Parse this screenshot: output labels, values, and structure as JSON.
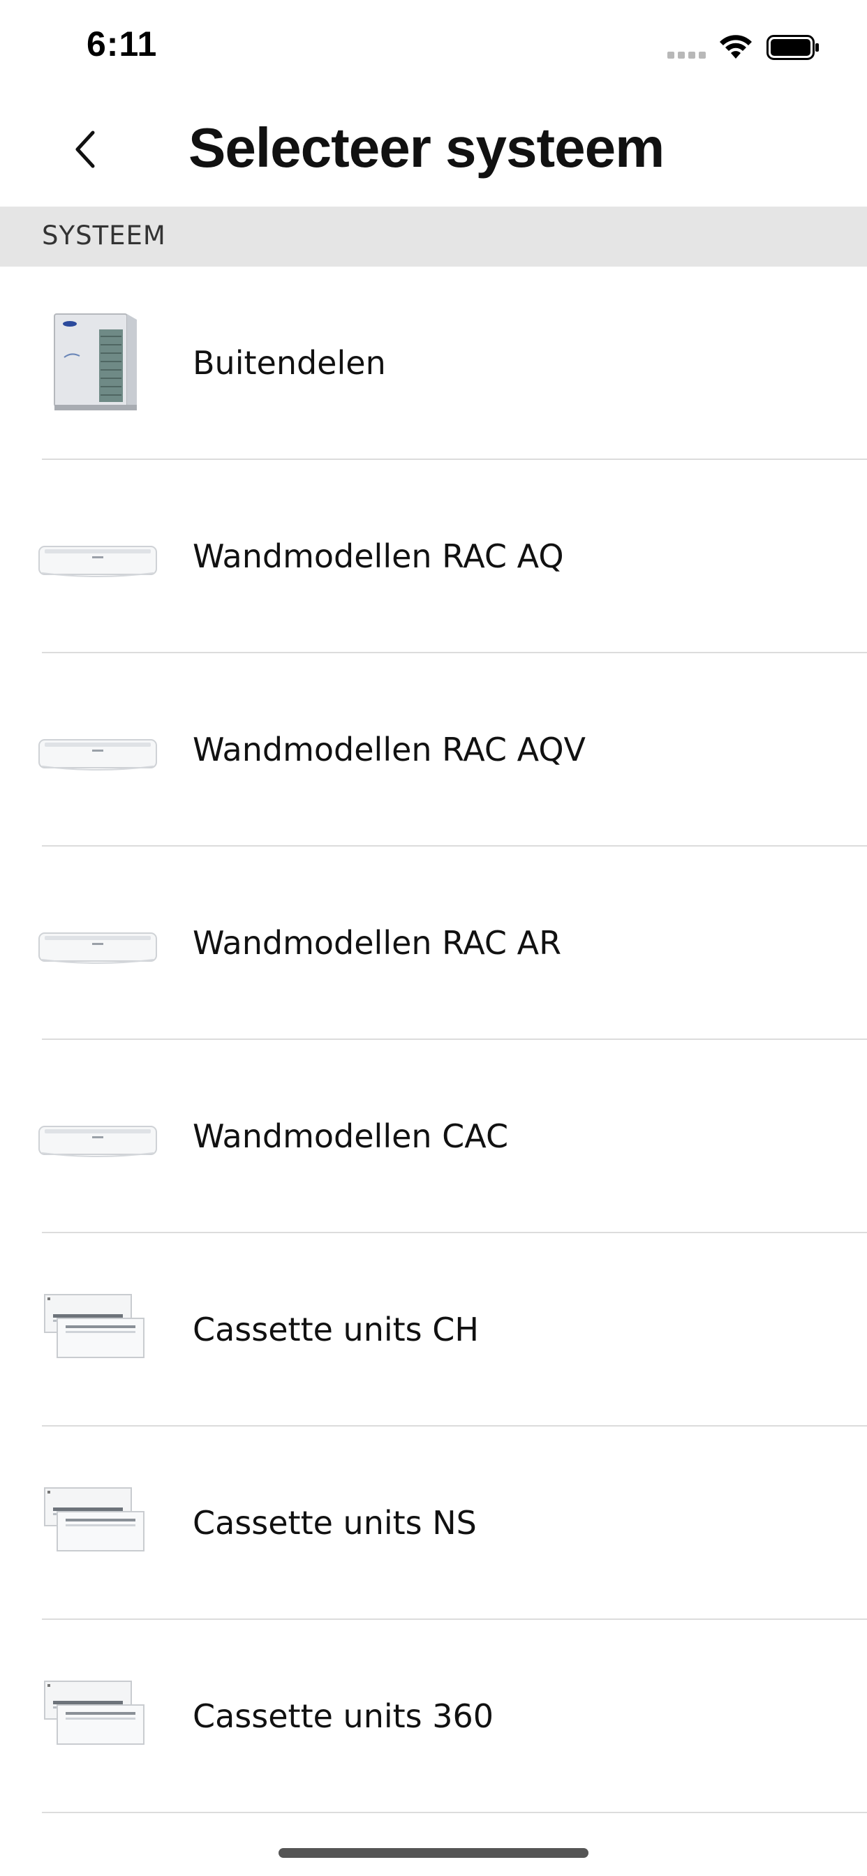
{
  "status_bar": {
    "time": "6:11",
    "signal_icon": "signal-dots-icon",
    "wifi_icon": "wifi-icon",
    "battery_icon": "battery-icon"
  },
  "nav": {
    "back_icon": "chevron-left-icon",
    "title": "Selecteer systeem"
  },
  "section": {
    "header": "SYSTEEM"
  },
  "items": [
    {
      "label": "Buitendelen",
      "icon": "outdoor-unit-icon"
    },
    {
      "label": "Wandmodellen RAC AQ",
      "icon": "wall-unit-icon"
    },
    {
      "label": "Wandmodellen RAC AQV",
      "icon": "wall-unit-icon"
    },
    {
      "label": "Wandmodellen RAC AR",
      "icon": "wall-unit-icon"
    },
    {
      "label": "Wandmodellen CAC",
      "icon": "wall-unit-icon"
    },
    {
      "label": "Cassette units CH",
      "icon": "cassette-unit-icon"
    },
    {
      "label": "Cassette units NS",
      "icon": "cassette-unit-icon"
    },
    {
      "label": "Cassette units 360",
      "icon": "cassette-unit-icon"
    }
  ],
  "colors": {
    "section_bg": "#e5e5e5",
    "divider": "#dcdcdc",
    "text": "#111111"
  }
}
